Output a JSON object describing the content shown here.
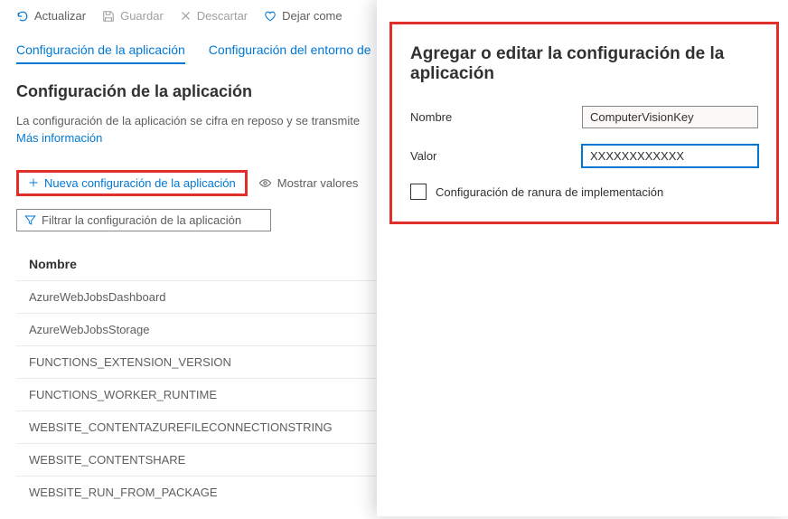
{
  "toolbar": {
    "refresh": "Actualizar",
    "save": "Guardar",
    "discard": "Descartar",
    "leave_as": "Dejar come"
  },
  "tabs": {
    "app_config": "Configuración de la aplicación",
    "runtime_env": "Configuración del entorno de"
  },
  "section": {
    "heading": "Configuración de la aplicación",
    "desc": "La configuración de la aplicación se cifra en reposo y se transmite",
    "more_info": "Más información"
  },
  "actions": {
    "new_setting": "Nueva configuración de la aplicación",
    "show_values": "Mostrar valores"
  },
  "filter": {
    "placeholder": "Filtrar la configuración de la aplicación"
  },
  "table": {
    "header_name": "Nombre",
    "rows": [
      "AzureWebJobsDashboard",
      "AzureWebJobsStorage",
      "FUNCTIONS_EXTENSION_VERSION",
      "FUNCTIONS_WORKER_RUNTIME",
      "WEBSITE_CONTENTAZUREFILECONNECTIONSTRING",
      "WEBSITE_CONTENTSHARE",
      "WEBSITE_RUN_FROM_PACKAGE"
    ]
  },
  "panel": {
    "title": "Agregar o editar la configuración de la aplicación",
    "name_label": "Nombre",
    "name_value": "ComputerVisionKey",
    "value_label": "Valor",
    "value_value": "XXXXXXXXXXXX",
    "slot_checkbox_label": "Configuración de ranura de implementación"
  }
}
